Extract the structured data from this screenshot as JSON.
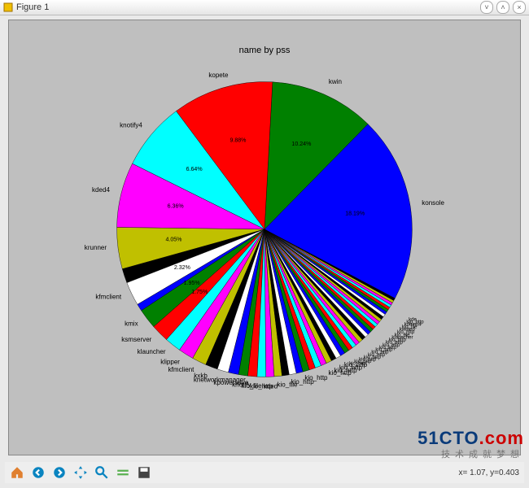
{
  "window": {
    "title": "Figure 1"
  },
  "watermark": {
    "brand1": "51CTO",
    "brand2": ".com",
    "tagline": "技术成就梦想"
  },
  "toolbar": {
    "coord": "x= 1.07, y=0.403"
  },
  "chart_data": {
    "type": "pie",
    "title": "name by pss",
    "series": [
      {
        "name": "konsole",
        "value": 18.19,
        "color": "#0000ff",
        "showPct": true
      },
      {
        "name": "kwin",
        "value": 10.24,
        "color": "#008000",
        "showPct": true
      },
      {
        "name": "kopete",
        "value": 9.88,
        "color": "#ff0000",
        "showPct": true
      },
      {
        "name": "knotify4",
        "value": 6.64,
        "color": "#00ffff",
        "showPct": true
      },
      {
        "name": "kded4",
        "value": 6.36,
        "color": "#ff00ff",
        "showPct": true
      },
      {
        "name": "krunner",
        "value": 4.05,
        "color": "#c0c000",
        "showPct": true
      },
      {
        "name": "",
        "value": 1.4,
        "color": "#000000"
      },
      {
        "name": "kfmclient",
        "value": 2.32,
        "color": "#ffffff",
        "showPct": true
      },
      {
        "name": "",
        "value": 0.7,
        "color": "#0000ff"
      },
      {
        "name": "kmix",
        "value": 1.95,
        "color": "#008000",
        "showPct": true
      },
      {
        "name": "ksmserver",
        "value": 1.75,
        "color": "#ff0000",
        "showPct": true
      },
      {
        "name": "klauncher",
        "value": 1.6,
        "color": "#00ffff"
      },
      {
        "name": "klipper",
        "value": 1.5,
        "color": "#ff00ff"
      },
      {
        "name": "kfmclient",
        "value": 1.4,
        "color": "#c0c000"
      },
      {
        "name": "kxkb",
        "value": 1.2,
        "color": "#000000"
      },
      {
        "name": "knetworkmanager",
        "value": 1.1,
        "color": "#ffffff"
      },
      {
        "name": "kpowersave",
        "value": 1.0,
        "color": "#0000ff"
      },
      {
        "name": "knotify",
        "value": 0.9,
        "color": "#008000"
      },
      {
        "name": "kio_file",
        "value": 0.9,
        "color": "#ff0000"
      },
      {
        "name": "kio_http",
        "value": 0.85,
        "color": "#00ffff"
      },
      {
        "name": "kded",
        "value": 0.8,
        "color": "#ff00ff"
      },
      {
        "name": "",
        "value": 0.75,
        "color": "#c0c000"
      },
      {
        "name": "kio_file",
        "value": 0.7,
        "color": "#000000"
      },
      {
        "name": "",
        "value": 0.7,
        "color": "#ffffff"
      },
      {
        "name": "kio_http",
        "value": 0.65,
        "color": "#0000ff"
      },
      {
        "name": "",
        "value": 0.65,
        "color": "#008000"
      },
      {
        "name": "kio_http",
        "value": 0.6,
        "color": "#ff0000"
      },
      {
        "name": "",
        "value": 0.6,
        "color": "#00ffff"
      },
      {
        "name": "kio_http",
        "value": 0.55,
        "color": "#ff00ff"
      },
      {
        "name": "kio_http",
        "value": 0.55,
        "color": "#c0c000"
      },
      {
        "name": "kio_http",
        "value": 0.5,
        "color": "#000000"
      },
      {
        "name": "kio_http",
        "value": 0.5,
        "color": "#ffffff"
      },
      {
        "name": "kio_http",
        "value": 0.48,
        "color": "#0000ff"
      },
      {
        "name": "kio_http",
        "value": 0.46,
        "color": "#008000"
      },
      {
        "name": "kio_http",
        "value": 0.44,
        "color": "#ff0000"
      },
      {
        "name": "kio_http",
        "value": 0.42,
        "color": "#00ffff"
      },
      {
        "name": "kio_http",
        "value": 0.4,
        "color": "#ff00ff"
      },
      {
        "name": "kio_http",
        "value": 0.4,
        "color": "#c0c000"
      },
      {
        "name": "kio_http",
        "value": 0.38,
        "color": "#000000"
      },
      {
        "name": "kio_http",
        "value": 0.36,
        "color": "#ffffff"
      },
      {
        "name": "kio_http",
        "value": 0.35,
        "color": "#0000ff"
      },
      {
        "name": "kio_http",
        "value": 0.34,
        "color": "#008000"
      },
      {
        "name": "kio_http",
        "value": 0.33,
        "color": "#ff0000"
      },
      {
        "name": "klauncher",
        "value": 0.32,
        "color": "#00ffff"
      },
      {
        "name": "kio_file",
        "value": 0.31,
        "color": "#ff00ff"
      },
      {
        "name": "kio_http",
        "value": 0.3,
        "color": "#c0c000"
      },
      {
        "name": "kwrited",
        "value": 0.3,
        "color": "#000000"
      },
      {
        "name": "kio_file",
        "value": 0.29,
        "color": "#ffffff"
      },
      {
        "name": "kdeinit4",
        "value": 0.28,
        "color": "#0000ff"
      },
      {
        "name": "kio_http",
        "value": 0.27,
        "color": "#008000"
      },
      {
        "name": "kde",
        "value": 0.26,
        "color": "#ff0000"
      },
      {
        "name": "",
        "value": 0.26,
        "color": "#00ffff"
      },
      {
        "name": "",
        "value": 0.25,
        "color": "#ff00ff"
      },
      {
        "name": "",
        "value": 0.25,
        "color": "#c0c000"
      },
      {
        "name": "",
        "value": 0.24,
        "color": "#000000"
      }
    ]
  }
}
